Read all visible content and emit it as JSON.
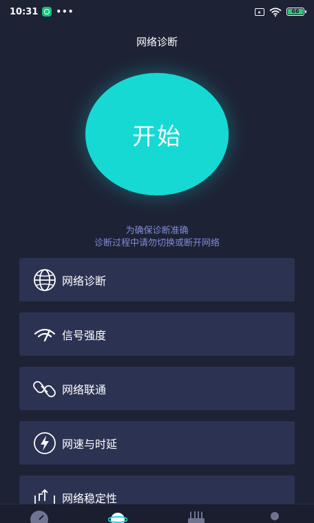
{
  "status_bar": {
    "time": "10:31",
    "more": "•••",
    "battery": "66"
  },
  "header": {
    "title": "网络诊断"
  },
  "start_button": {
    "label": "开始"
  },
  "hint": {
    "line1": "为确保诊断准确",
    "line2": "诊断过程中请勿切换或断开网络"
  },
  "menu": {
    "items": [
      {
        "label": "网络诊断",
        "icon": "globe-icon"
      },
      {
        "label": "信号强度",
        "icon": "signal-gauge-icon"
      },
      {
        "label": "网络联通",
        "icon": "link-icon"
      },
      {
        "label": "网速与时延",
        "icon": "lightning-icon"
      },
      {
        "label": "网络稳定性",
        "icon": "stability-icon"
      }
    ]
  },
  "bottom_nav": {
    "items": [
      {
        "icon": "speedometer-icon"
      },
      {
        "icon": "planet-icon"
      },
      {
        "icon": "router-icon"
      },
      {
        "icon": "user-icon"
      }
    ]
  },
  "colors": {
    "background": "#1e2235",
    "card": "#2c3352",
    "accent": "#16d9d4",
    "hint_text": "#7f8bd6"
  }
}
